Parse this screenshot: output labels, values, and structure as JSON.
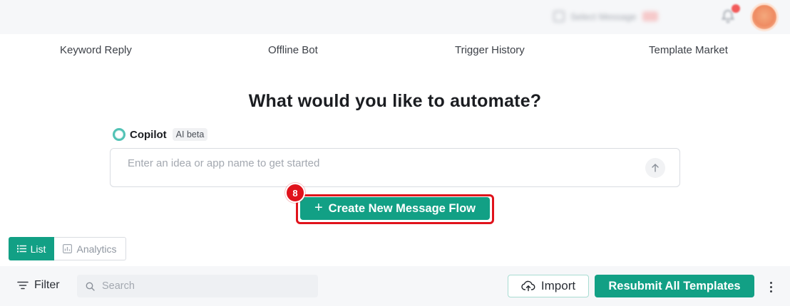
{
  "header": {
    "blurred_label": "Select Message",
    "icons": [
      "bell-icon",
      "avatar"
    ]
  },
  "nav": {
    "tabs": [
      {
        "label": "Keyword Reply"
      },
      {
        "label": "Offline Bot"
      },
      {
        "label": "Trigger History"
      },
      {
        "label": "Template Market"
      }
    ]
  },
  "main": {
    "headline": "What would you like to automate?",
    "copilot": {
      "name": "Copilot",
      "badge": "AI beta"
    },
    "idea_input": {
      "placeholder": "Enter an idea or app name to get started",
      "value": ""
    },
    "create_button": {
      "plus": "+",
      "label": "Create New Message Flow"
    },
    "step_badge": "8"
  },
  "view_toggle": {
    "list_label": "List",
    "analytics_label": "Analytics",
    "selected": "List"
  },
  "toolbar": {
    "filter_label": "Filter",
    "search_placeholder": "Search",
    "import_label": "Import",
    "resubmit_label": "Resubmit All Templates"
  },
  "colors": {
    "accent": "#12a085",
    "highlight": "#e0121b",
    "toolbar_bg": "#f6f7f9"
  }
}
